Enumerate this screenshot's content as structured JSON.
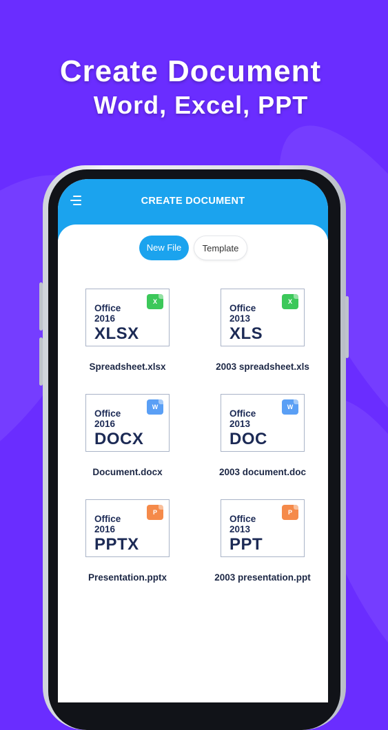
{
  "headline": {
    "line1": "Create Document",
    "line2": "Word, Excel, PPT"
  },
  "app": {
    "menu_icon": "hamburger-menu-icon",
    "title": "CREATE DOCUMENT",
    "accent": "#1ba3ee"
  },
  "tabs": [
    {
      "label": "New File",
      "active": true
    },
    {
      "label": "Template",
      "active": false
    }
  ],
  "files": [
    {
      "office": "Office",
      "year": "2016",
      "format": "XLSX",
      "badge": "X",
      "badge_icon": "excel-icon",
      "badge_color": "#3cc85a",
      "name": "Spreadsheet.xlsx"
    },
    {
      "office": "Office",
      "year": "2013",
      "format": "XLS",
      "badge": "X",
      "badge_icon": "excel-icon",
      "badge_color": "#3cc85a",
      "name": "2003 spreadsheet.xls"
    },
    {
      "office": "Office",
      "year": "2016",
      "format": "DOCX",
      "badge": "W",
      "badge_icon": "word-icon",
      "badge_color": "#5a9ff5",
      "name": "Document.docx"
    },
    {
      "office": "Office",
      "year": "2013",
      "format": "DOC",
      "badge": "W",
      "badge_icon": "word-icon",
      "badge_color": "#5a9ff5",
      "name": "2003 document.doc"
    },
    {
      "office": "Office",
      "year": "2016",
      "format": "PPTX",
      "badge": "P",
      "badge_icon": "powerpoint-icon",
      "badge_color": "#f58a4a",
      "name": "Presentation.pptx"
    },
    {
      "office": "Office",
      "year": "2013",
      "format": "PPT",
      "badge": "P",
      "badge_icon": "powerpoint-icon",
      "badge_color": "#f58a4a",
      "name": "2003 presentation.ppt"
    }
  ],
  "colors": {
    "background": "#6a2dff",
    "thumb_text": "#1c2a55"
  }
}
